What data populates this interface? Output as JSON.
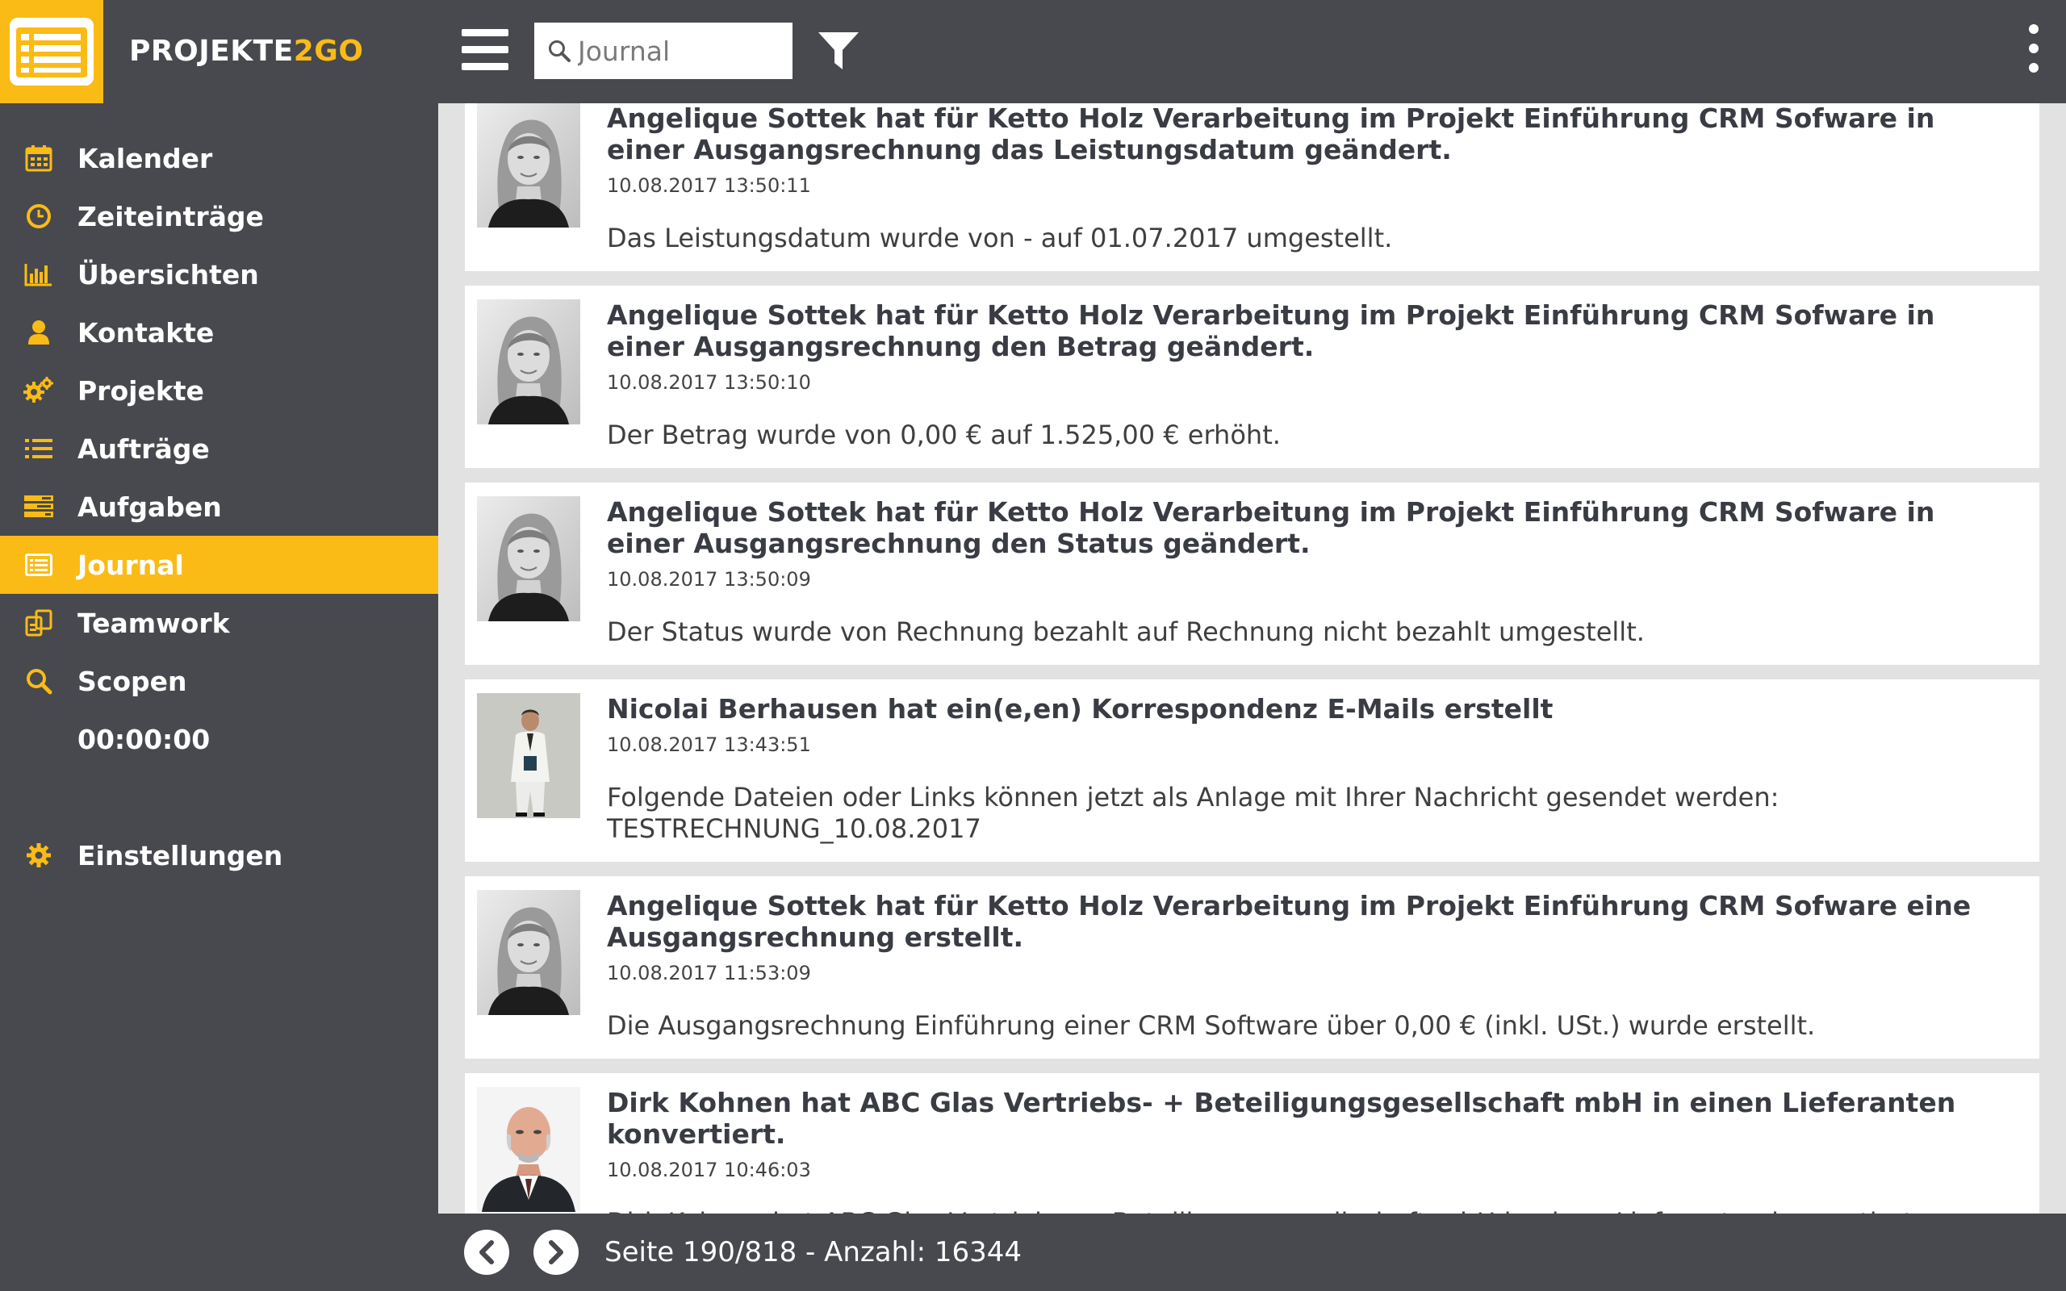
{
  "app": {
    "brand_main": "PROJEKTE",
    "brand_accent": "2GO",
    "accent_color": "#fbbb16",
    "chrome_color": "#48494e"
  },
  "sidebar": {
    "items": [
      {
        "label": "Kalender",
        "icon": "calendar-icon"
      },
      {
        "label": "Zeiteinträge",
        "icon": "clock-icon"
      },
      {
        "label": "Übersichten",
        "icon": "bar-chart-icon"
      },
      {
        "label": "Kontakte",
        "icon": "person-icon"
      },
      {
        "label": "Projekte",
        "icon": "gears-icon"
      },
      {
        "label": "Aufträge",
        "icon": "list-icon"
      },
      {
        "label": "Aufgaben",
        "icon": "tasks-icon"
      },
      {
        "label": "Journal",
        "icon": "journal-icon",
        "active": true
      },
      {
        "label": "Teamwork",
        "icon": "teamwork-icon"
      },
      {
        "label": "Scopen",
        "icon": "search-icon"
      }
    ],
    "timer": "00:00:00",
    "settings": {
      "label": "Einstellungen",
      "icon": "gear-icon"
    }
  },
  "topbar": {
    "search_placeholder": "Journal",
    "search_value": ""
  },
  "journal": {
    "entries": [
      {
        "title": "Angelique Sottek hat für Ketto Holz Verarbeitung im Projekt Einführung CRM Sofware in einer Ausgangsrechnung das Leistungsdatum geändert.",
        "time": "10.08.2017 13:50:11",
        "body": "Das Leistungsdatum wurde von - auf 01.07.2017 umgestellt.",
        "avatar": "woman"
      },
      {
        "title": "Angelique Sottek hat für Ketto Holz Verarbeitung im Projekt Einführung CRM Sofware in einer Ausgangsrechnung den Betrag geändert.",
        "time": "10.08.2017 13:50:10",
        "body": "Der Betrag wurde von 0,00 € auf 1.525,00 € erhöht.",
        "avatar": "woman"
      },
      {
        "title": "Angelique Sottek hat für Ketto Holz Verarbeitung im Projekt Einführung CRM Sofware in einer Ausgangsrechnung den Status geändert.",
        "time": "10.08.2017 13:50:09",
        "body": "Der Status wurde von Rechnung bezahlt auf Rechnung nicht bezahlt umgestellt.",
        "avatar": "woman"
      },
      {
        "title": "Nicolai Berhausen hat ein(e,en) Korrespondenz E-Mails erstellt",
        "time": "10.08.2017 13:43:51",
        "body": "Folgende Dateien oder Links können jetzt als Anlage mit Ihrer Nachricht gesendet werden: TESTRECHNUNG_10.08.2017",
        "avatar": "man-suit"
      },
      {
        "title": "Angelique Sottek hat für Ketto Holz Verarbeitung im Projekt Einführung CRM Sofware eine Ausgangsrechnung erstellt.",
        "time": "10.08.2017 11:53:09",
        "body": "Die Ausgangsrechnung Einführung einer CRM Software über 0,00 € (inkl. USt.) wurde erstellt.",
        "avatar": "woman"
      },
      {
        "title": "Dirk Kohnen hat ABC Glas Vertriebs- + Beteiligungsgesellschaft mbH in einen Lieferanten konvertiert.",
        "time": "10.08.2017 10:46:03",
        "body": "Dirk Kohnen hat ABC Glas Vertriebs- + Beteiligungsgesellschaft mbH in einen Lieferanten konvertiert.",
        "avatar": "man-bald"
      }
    ]
  },
  "footer": {
    "pager_text": "Seite 190/818 - Anzahl: 16344"
  }
}
